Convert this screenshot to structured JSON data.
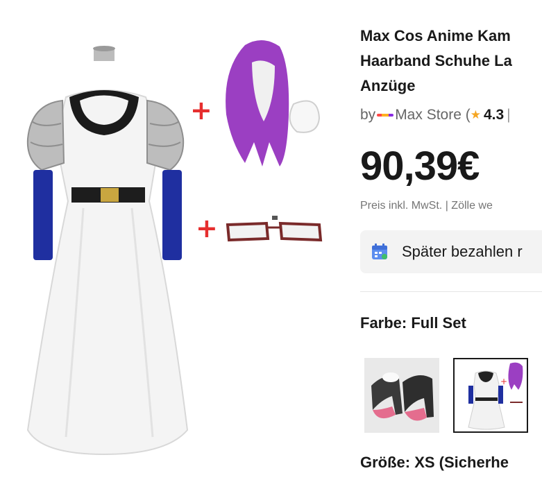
{
  "product": {
    "title_lines": [
      "Max Cos Anime Kam",
      "Haarband Schuhe La",
      "Anzüge"
    ],
    "store_prefix": "by",
    "store_name": "Max Store",
    "store_open": " (",
    "rating": "4.3",
    "rating_sep": "|",
    "price": "90,39€",
    "tax_note": "Preis inkl. MwSt. | Zölle we",
    "pay_later": "Später bezahlen r",
    "color_label": "Farbe: Full Set",
    "size_label": "Größe: XS (Sicherhe",
    "accent_color": "#e62e2e",
    "icons": [
      "plus-icon",
      "star-icon",
      "calendar-icon"
    ]
  }
}
